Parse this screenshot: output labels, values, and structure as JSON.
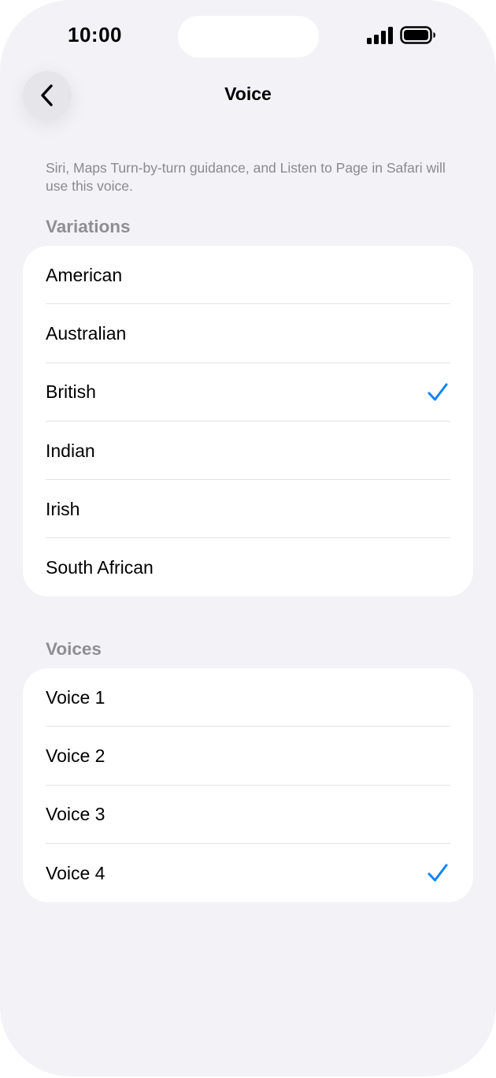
{
  "status_bar": {
    "time": "10:00",
    "icons": [
      "cellular-signal-icon",
      "battery-icon"
    ]
  },
  "nav": {
    "back_icon": "chevron-left-icon",
    "title": "Voice"
  },
  "description": "Siri, Maps Turn-by-turn guidance, and Listen to Page in Safari will use this voice.",
  "variations": {
    "header": "Variations",
    "items": [
      {
        "label": "American",
        "selected": false
      },
      {
        "label": "Australian",
        "selected": false
      },
      {
        "label": "British",
        "selected": true
      },
      {
        "label": "Indian",
        "selected": false
      },
      {
        "label": "Irish",
        "selected": false
      },
      {
        "label": "South African",
        "selected": false
      }
    ]
  },
  "voices": {
    "header": "Voices",
    "items": [
      {
        "label": "Voice 1",
        "selected": false
      },
      {
        "label": "Voice 2",
        "selected": false
      },
      {
        "label": "Voice 3",
        "selected": false
      },
      {
        "label": "Voice 4",
        "selected": true
      }
    ]
  },
  "colors": {
    "background": "#f2f2f7",
    "card": "#ffffff",
    "accent": "#0a84ff",
    "secondary_text": "#8e8e93"
  }
}
